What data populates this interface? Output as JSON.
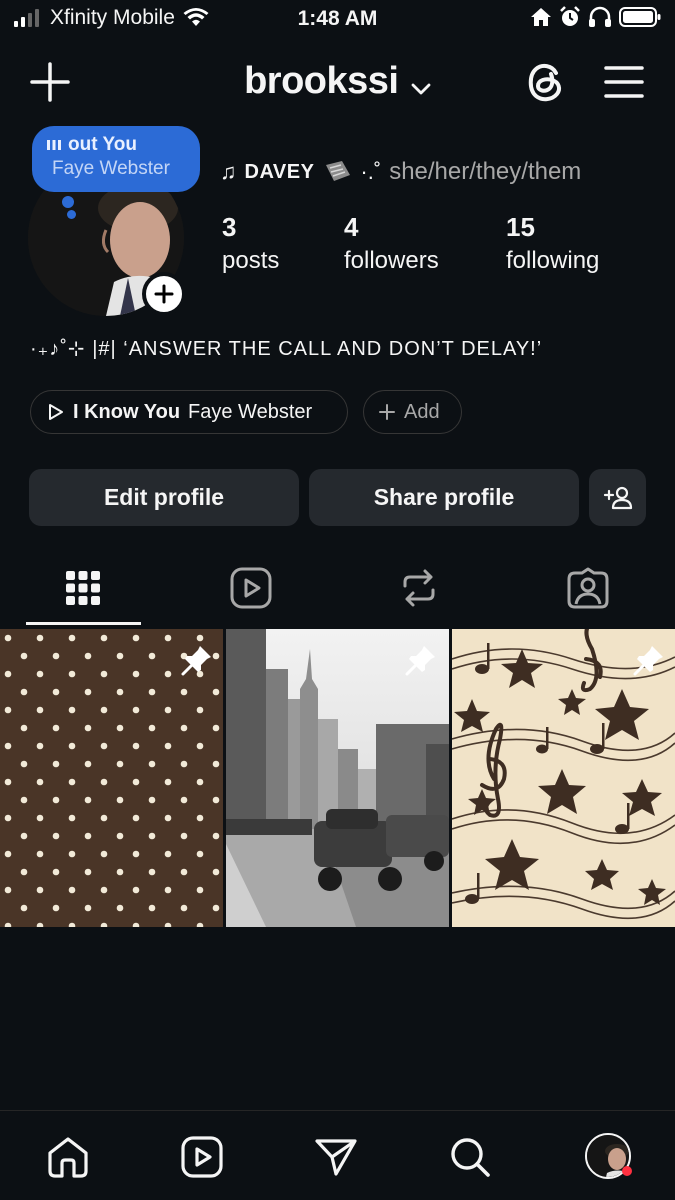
{
  "status_bar": {
    "carrier": "Xfinity Mobile",
    "time": "1:48 AM",
    "icons": [
      "signal-icon",
      "wifi-icon",
      "home-icon",
      "alarm-icon",
      "headphones-icon",
      "battery-icon"
    ]
  },
  "header": {
    "username": "brookssi"
  },
  "note": {
    "title": "out You",
    "artist": "Faye Webster"
  },
  "profile": {
    "name_line_music": "♫",
    "name": "DAVEY",
    "name_suffix": "·.˚",
    "pronouns": "she/her/they/them",
    "bio": "·₊♪˚⊹ |#| ‘ANSWER THE CALL AND DON’T DELAY!’"
  },
  "stats": {
    "posts": {
      "value": "3",
      "label": "posts"
    },
    "followers": {
      "value": "4",
      "label": "followers"
    },
    "following": {
      "value": "15",
      "label": "following"
    }
  },
  "music_chip": {
    "song": "I Know You",
    "artist": "Faye Webster"
  },
  "add_chip": {
    "label": "Add"
  },
  "buttons": {
    "edit": "Edit profile",
    "share": "Share profile"
  },
  "tabs": [
    "grid-icon",
    "reels-icon",
    "reposts-icon",
    "tagged-icon"
  ],
  "posts": [
    {
      "name": "polka-dot-post",
      "pinned": true
    },
    {
      "name": "city-street-post",
      "pinned": true
    },
    {
      "name": "music-stars-post",
      "pinned": true
    }
  ],
  "colors": {
    "background": "#0c1014",
    "note_blue": "#2c6bd6",
    "button_bg": "#25292e",
    "notification_red": "#ff3040"
  }
}
